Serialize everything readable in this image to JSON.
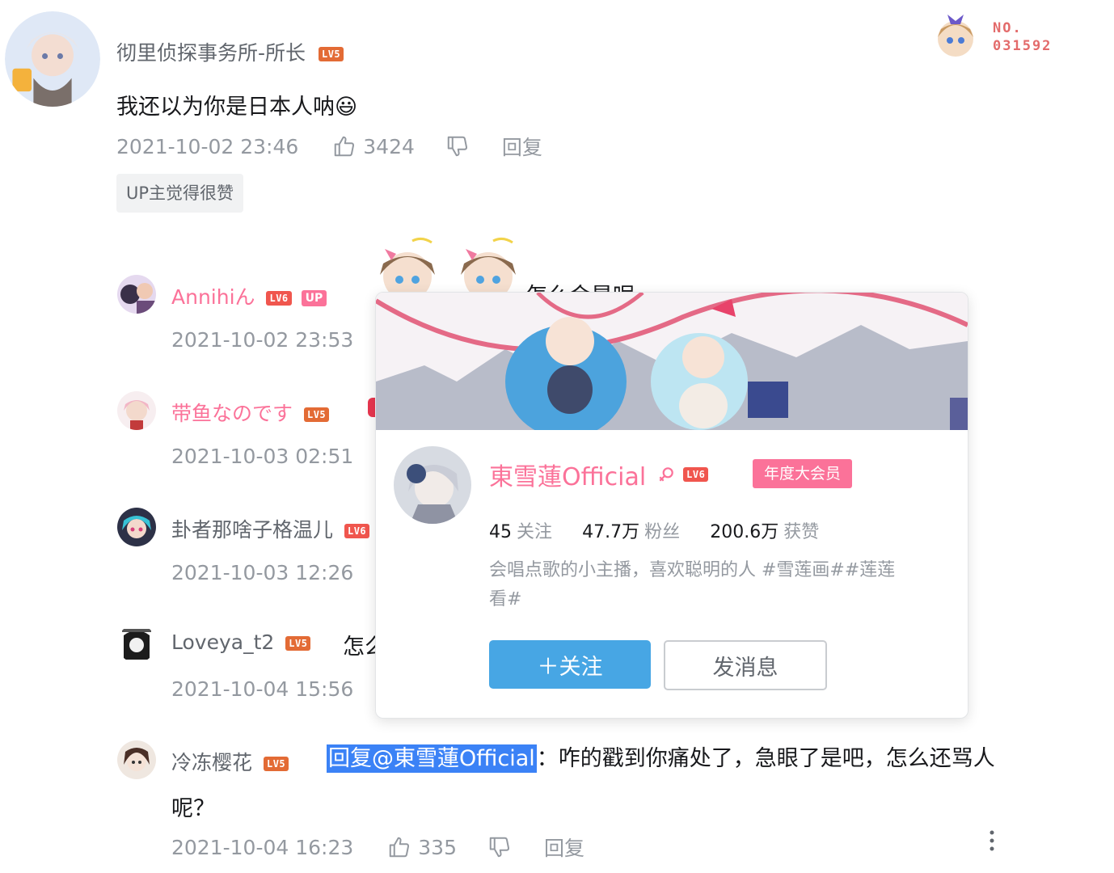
{
  "main_comment": {
    "username": "彻里侦探事务所-所长",
    "level": "LV5",
    "text": "我还以为你是日本人呐😃",
    "time": "2021-10-02 23:46",
    "likes": "3424",
    "reply_label": "回复",
    "tag": "UP主觉得很赞",
    "fan_badge_no": "NO.",
    "fan_badge_num": "031592"
  },
  "replies": [
    {
      "username": "Annihiん",
      "level": "LV6",
      "badge": "UP",
      "text": "怎么会是呢",
      "time": "2021-10-02 23:53"
    },
    {
      "username": "带鱼なのです",
      "level": "LV5",
      "time": "2021-10-03 02:51"
    },
    {
      "username": "卦者那啥子格温儿",
      "level": "LV6",
      "time": "2021-10-03 12:26"
    },
    {
      "username": "Loveya_t2",
      "level": "LV5",
      "text": "怎么",
      "time": "2021-10-04 15:56"
    },
    {
      "username": "冷冻樱花",
      "level": "LV5",
      "reply_prefix": "回复@東雪蓮Official",
      "text_line1": "：咋的戳到你痛处了，急眼了是吧，怎么还骂人",
      "text_line2": "呢？",
      "time": "2021-10-04 16:23",
      "likes": "335",
      "reply_label": "回复"
    }
  ],
  "user_card": {
    "name": "東雪蓮Official",
    "gender_icon": "female-icon",
    "level": "LV6",
    "vip_label": "年度大会员",
    "following_count": "45",
    "following_label": "关注",
    "fans_count": "47.7万",
    "fans_label": "粉丝",
    "likes_count": "200.6万",
    "likes_label": "获赞",
    "bio_line1": "会唱点歌的小主播，喜欢聪明的人 #雪莲画##莲莲",
    "bio_line2": "看#",
    "follow_button": "＋关注",
    "message_button": "发消息"
  },
  "colors": {
    "brand_pink": "#fb7299",
    "brand_blue": "#47a6e4",
    "highlight_blue": "#3b82f6",
    "level_orange": "#e36b35"
  }
}
